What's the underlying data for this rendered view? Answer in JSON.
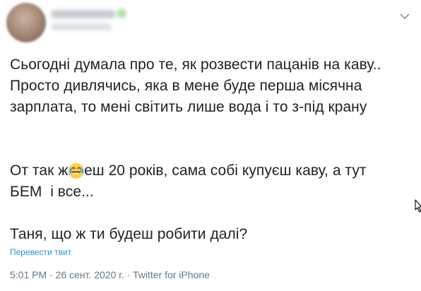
{
  "tweet": {
    "text_lines_1": [
      "Сьогодні думала про те, як розвести пацанів на каву..",
      "Просто дивлячись, яка в мене буде перша місячна",
      "зарплата, то мені світить лише вода і то з-під крану"
    ],
    "emoji": "face-with-tears-of-joy",
    "text_lines_2": [
      "От так живеш 20 років, сама собі купуєш каву, а тут",
      "БЕМ  і все..."
    ],
    "text_lines_3": [
      "Таня, що ж ти будеш робити далі?"
    ],
    "translate_label": "Перевести твит",
    "time": "5:01 PM",
    "date": "26 сент. 2020 г.",
    "source": "Twitter for iPhone",
    "separator": "·"
  },
  "colors": {
    "text": "#1c2125",
    "link": "#1b95e0",
    "meta": "#657786"
  },
  "icons": {
    "caret": "chevron-down-icon",
    "cursor": "resize-cursor-icon"
  }
}
